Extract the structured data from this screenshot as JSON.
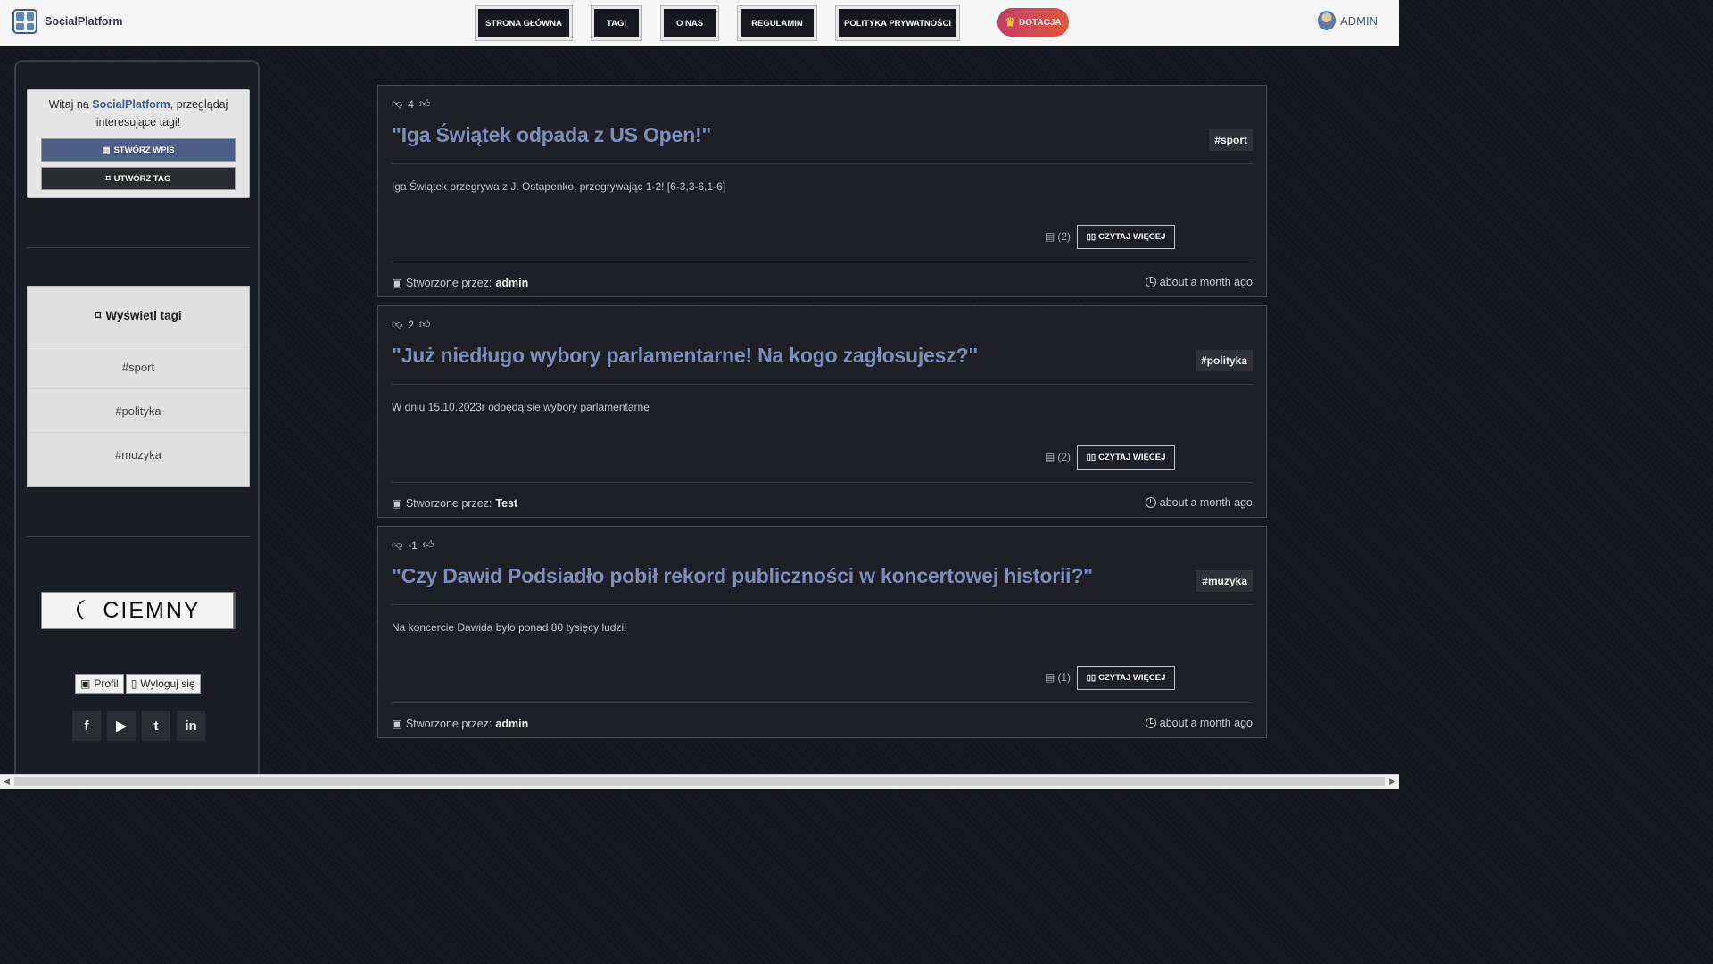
{
  "header": {
    "brand": "SocialPlatform",
    "nav": [
      "STRONA GŁÓWNA",
      "TAGI",
      "O NAS",
      "REGULAMIN",
      "POLITYKA PRYWATNOŚCI"
    ],
    "donate": "DOTACJA",
    "user": "ADMIN"
  },
  "sidebar": {
    "welcome_prefix": "Witaj na ",
    "welcome_brand": "SocialPlatform",
    "welcome_suffix": ", przeglądaj interesujące tagi!",
    "create_post": "STWÓRZ WPIS",
    "create_tag": "UTWÓRZ TAG",
    "tags_title": "Wyświetl tagi",
    "tags": [
      "#sport",
      "#polityka",
      "#muzyka"
    ],
    "theme": "CIEMNY",
    "profile": "Profil",
    "logout": "Wyloguj się",
    "social": [
      "f",
      "▶",
      "t",
      "in"
    ]
  },
  "posts": [
    {
      "votes": "4",
      "title": "\"Iga Świątek odpada z US Open!\"",
      "tag": "#sport",
      "body": "Iga Świątek przegrywa z J. Ostapenko, przegrywając 1-2! [6-3,3-6,1-6]",
      "comments": "(2)",
      "read_more": "CZYTAJ WIĘCEJ",
      "author_label": "Stworzone przez:",
      "author": "admin",
      "time": "about a month ago"
    },
    {
      "votes": "2",
      "title": "\"Już niedługo wybory parlamentarne! Na kogo zagłosujesz?\"",
      "tag": "#polityka",
      "body": "W dniu 15.10.2023r odbędą sie wybory parlamentarne",
      "comments": "(2)",
      "read_more": "CZYTAJ WIĘCEJ",
      "author_label": "Stworzone przez:",
      "author": "Test",
      "time": "about a month ago"
    },
    {
      "votes": "-1",
      "title": "\"Czy Dawid Podsiadło pobił rekord publiczności w koncertowej historii?\"",
      "tag": "#muzyka",
      "body": "Na koncercie Dawida było ponad 80 tysięcy ludzi!",
      "comments": "(1)",
      "read_more": "CZYTAJ WIĘCEJ",
      "author_label": "Stworzone przez:",
      "author": "admin",
      "time": "about a month ago"
    }
  ]
}
